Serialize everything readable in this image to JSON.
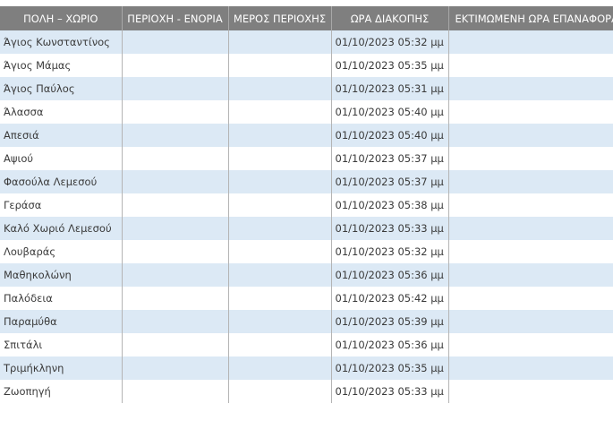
{
  "table": {
    "headers": [
      "ΠΟΛΗ – ΧΩΡΙΟ",
      "ΠΕΡΙΟΧΗ - ΕΝΟΡΙΑ",
      "ΜΕΡΟΣ ΠΕΡΙΟΧΗΣ",
      "ΩΡΑ ΔΙΑΚΟΠΗΣ",
      "ΕΚΤΙΜΩΜΕΝΗ ΩΡΑ ΕΠΑΝΑΦΟΡΑΣ"
    ],
    "rows": [
      [
        "Άγιος Κωνσταντίνος",
        "",
        "",
        "01/10/2023 05:32 μμ",
        ""
      ],
      [
        "Άγιος Μάμας",
        "",
        "",
        "01/10/2023 05:35 μμ",
        ""
      ],
      [
        "Άγιος Παύλος",
        "",
        "",
        "01/10/2023 05:31 μμ",
        ""
      ],
      [
        "Άλασσα",
        "",
        "",
        "01/10/2023 05:40 μμ",
        ""
      ],
      [
        "Απεσιά",
        "",
        "",
        "01/10/2023 05:40 μμ",
        ""
      ],
      [
        "Αψιού",
        "",
        "",
        "01/10/2023 05:37 μμ",
        ""
      ],
      [
        "Φασούλα Λεμεσού",
        "",
        "",
        "01/10/2023 05:37 μμ",
        ""
      ],
      [
        "Γεράσα",
        "",
        "",
        "01/10/2023 05:38 μμ",
        ""
      ],
      [
        "Καλό Χωριό Λεμεσού",
        "",
        "",
        "01/10/2023 05:33 μμ",
        ""
      ],
      [
        "Λουβαράς",
        "",
        "",
        "01/10/2023 05:32 μμ",
        ""
      ],
      [
        "Μαθηκολώνη",
        "",
        "",
        "01/10/2023 05:36 μμ",
        ""
      ],
      [
        "Παλόδεια",
        "",
        "",
        "01/10/2023 05:42 μμ",
        ""
      ],
      [
        "Παραμύθα",
        "",
        "",
        "01/10/2023 05:39 μμ",
        ""
      ],
      [
        "Σπιτάλι",
        "",
        "",
        "01/10/2023 05:36 μμ",
        ""
      ],
      [
        "Τριμήκληνη",
        "",
        "",
        "01/10/2023 05:35 μμ",
        ""
      ],
      [
        "Ζωοπηγή",
        "",
        "",
        "01/10/2023 05:33 μμ",
        ""
      ]
    ]
  },
  "colors": {
    "header_bg": "#7f7f7f",
    "header_text": "#ffffff",
    "row_alt_bg": "#dce9f5",
    "row_bg": "#ffffff"
  }
}
